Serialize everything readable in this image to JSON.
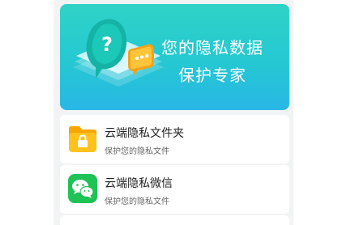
{
  "banner": {
    "line1": "您的隐私数据",
    "line2": "保护专家"
  },
  "items": [
    {
      "title": "云端隐私文件夹",
      "subtitle": "保护您的隐私文件",
      "icon": "folder-lock-icon",
      "icon_color": "#f7b500"
    },
    {
      "title": "云端隐私微信",
      "subtitle": "保护您的隐私文件",
      "icon": "wechat-icon",
      "icon_color": "#1fc255"
    }
  ],
  "colors": {
    "banner_top": "#2fd3c6",
    "banner_bottom": "#29b7e6",
    "page_bg": "#f2f3f5"
  }
}
